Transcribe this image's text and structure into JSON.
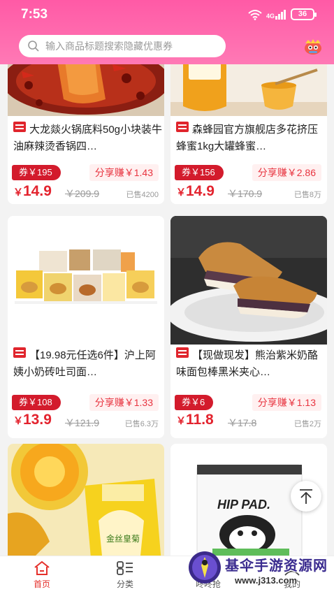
{
  "status_bar": {
    "time": "7:53",
    "signal": "4G",
    "battery": "36"
  },
  "search": {
    "placeholder": "输入商品标题搜索隐藏优惠券"
  },
  "products": [
    {
      "title": "大龙燚火锅底料50g小块装牛油麻辣烫香锅四…",
      "tmall": true,
      "coupon": "券￥195",
      "share": "分享赚￥1.43",
      "price_yen": "￥",
      "price": "14.9",
      "original": "￥209.9",
      "sold": "已售4200"
    },
    {
      "title": "森蜂园官方旗舰店多花挤压蜂蜜1kg大罐蜂蜜…",
      "tmall": true,
      "coupon": "券￥156",
      "share": "分享赚￥2.86",
      "price_yen": "￥",
      "price": "14.9",
      "original": "￥170.9",
      "sold": "已售8万"
    },
    {
      "title": "【19.98元任选6件】沪上阿姨小奶砖吐司面…",
      "tmall": true,
      "coupon": "券￥108",
      "share": "分享赚￥1.33",
      "price_yen": "￥",
      "price": "13.9",
      "original": "￥121.9",
      "sold": "已售6.3万"
    },
    {
      "title": "【现做现发】熊治紫米奶酪味面包棒黑米夹心…",
      "tmall": true,
      "coupon": "券￥6",
      "share": "分享赚￥1.13",
      "price_yen": "￥",
      "price": "11.8",
      "original": "￥17.8",
      "sold": "已售2万"
    }
  ],
  "images": {
    "p5_package_text": "金丝皇菊",
    "p6_package_text": "HIP PAD."
  },
  "tabbar": [
    {
      "label": "首页",
      "icon": "home-icon",
      "active": true
    },
    {
      "label": "分类",
      "icon": "category-icon",
      "active": false
    },
    {
      "label": "咚咚抢",
      "icon": "flash-sale-icon",
      "active": false
    },
    {
      "label": "我的",
      "icon": "profile-icon",
      "active": false
    }
  ],
  "watermark": {
    "name": "基伞手游资源网",
    "url": "www.j313.com"
  },
  "colors": {
    "header_pink": "#ff5aa6",
    "price_red": "#e3232e",
    "coupon_red": "#d31b2c",
    "tab_active": "#e5302b"
  }
}
